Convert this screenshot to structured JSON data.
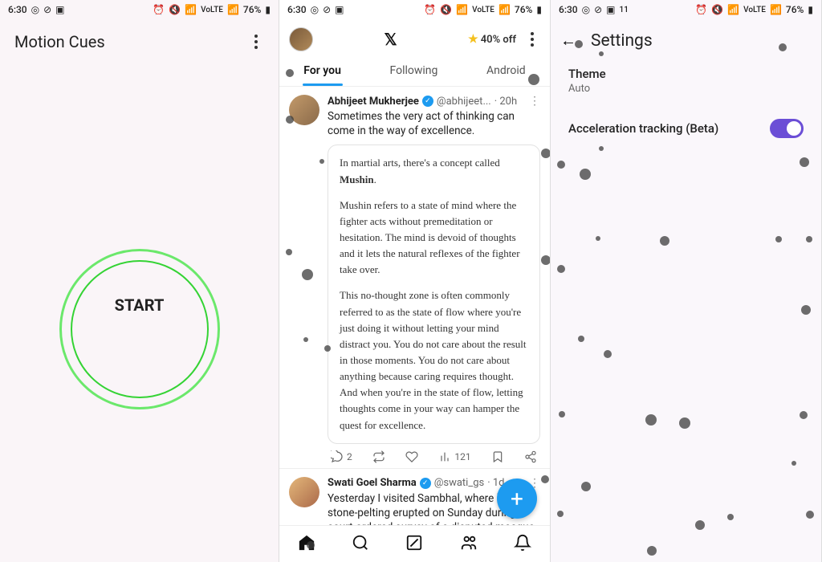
{
  "status": {
    "time": "6:30",
    "battery": "76%",
    "net": "VoLTE"
  },
  "pane1": {
    "title": "Motion Cues",
    "start": "START"
  },
  "pane2": {
    "promo": "40% off",
    "tabs": [
      "For you",
      "Following",
      "Android"
    ],
    "tweets": [
      {
        "name": "Abhijeet Mukherjee",
        "handle": "@abhijeet...",
        "time": "20h",
        "text": "Sometimes the very act of thinking can come in the way of excellence.",
        "quote": {
          "p1_a": "In martial arts, there's a concept called ",
          "p1_b": "Mushin",
          "p1_c": ".",
          "p2": "Mushin refers to a state of mind where the fighter acts without premeditation or hesitation. The mind is devoid of thoughts and it lets the natural reflexes of the fighter take over.",
          "p3": "This no-thought zone is often commonly referred to as the state of flow where you're just doing it without letting your mind distract you. You do not care about the result in those moments. You do not care about anything because caring requires thought. And when you're in the state of flow, letting thoughts come in your way can hamper the quest for excellence."
        },
        "reply_count": "2",
        "views": "121"
      },
      {
        "name": "Swati Goel Sharma",
        "handle": "@swati_gs",
        "time": "1d",
        "text": "Yesterday I visited Sambhal, where heavy stone-pelting erupted on Sunday during court-ordered survey of a disputed mosque structure"
      }
    ]
  },
  "pane3": {
    "title": "Settings",
    "theme_label": "Theme",
    "theme_value": "Auto",
    "accel_label": "Acceleration tracking (Beta)"
  }
}
